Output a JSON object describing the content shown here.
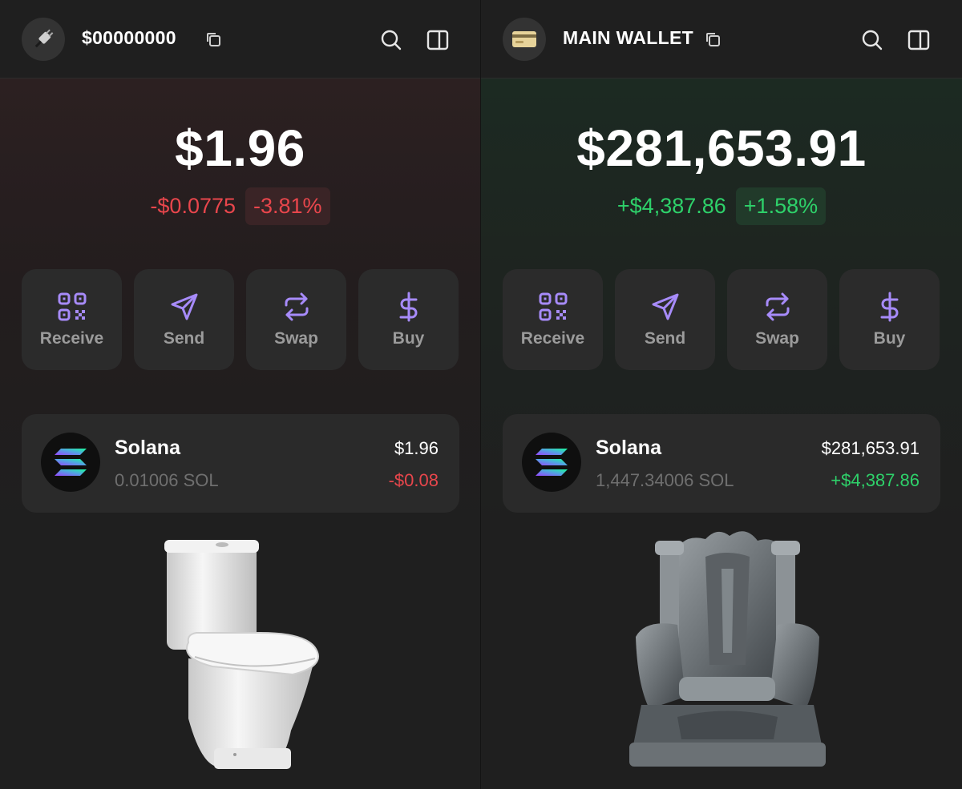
{
  "colors": {
    "background": "#1f1f1f",
    "accent_purple": "#a78bfa",
    "negative": "#e8464c",
    "positive": "#2ed16a"
  },
  "left_wallet": {
    "name": "$00000000",
    "avatar_icon": "plug-icon",
    "balance": "$1.96",
    "change_amount": "-$0.0775",
    "change_percent": "-3.81%",
    "trend": "negative",
    "actions": [
      {
        "label": "Receive",
        "icon": "qr-code-icon"
      },
      {
        "label": "Send",
        "icon": "send-icon"
      },
      {
        "label": "Swap",
        "icon": "swap-icon"
      },
      {
        "label": "Buy",
        "icon": "dollar-icon"
      }
    ],
    "token": {
      "name": "Solana",
      "amount": "0.01006 SOL",
      "value": "$1.96",
      "change": "-$0.08"
    },
    "illustration": "toilet"
  },
  "right_wallet": {
    "name": "MAIN WALLET",
    "avatar_icon": "credit-card-icon",
    "balance": "$281,653.91",
    "change_amount": "+$4,387.86",
    "change_percent": "+1.58%",
    "trend": "positive",
    "actions": [
      {
        "label": "Receive",
        "icon": "qr-code-icon"
      },
      {
        "label": "Send",
        "icon": "send-icon"
      },
      {
        "label": "Swap",
        "icon": "swap-icon"
      },
      {
        "label": "Buy",
        "icon": "dollar-icon"
      }
    ],
    "token": {
      "name": "Solana",
      "amount": "1,447.34006 SOL",
      "value": "$281,653.91",
      "change": "+$4,387.86"
    },
    "illustration": "stone-throne"
  }
}
